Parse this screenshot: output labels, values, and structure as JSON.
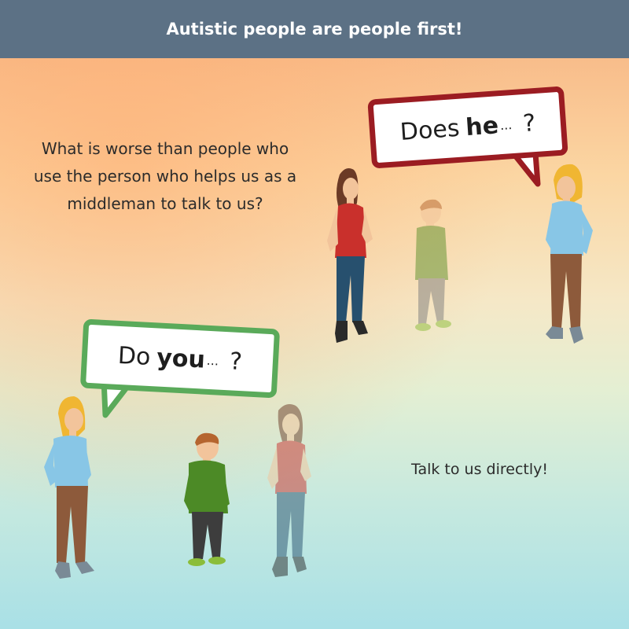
{
  "title": "Autistic people are people first!",
  "question": "What is worse than people who use the person who helps us as a middleman to talk to us?",
  "answer": "Talk to us directly!",
  "bubble_red": {
    "prefix": "Does",
    "emphasis": "he",
    "dots": "...",
    "mark": "?"
  },
  "bubble_green": {
    "prefix": "Do",
    "emphasis": "you",
    "dots": "...",
    "mark": "?"
  },
  "colors": {
    "title_bar": "#5c7185",
    "red_bubble": "#9b1c22",
    "green_bubble": "#5aaa5a"
  }
}
